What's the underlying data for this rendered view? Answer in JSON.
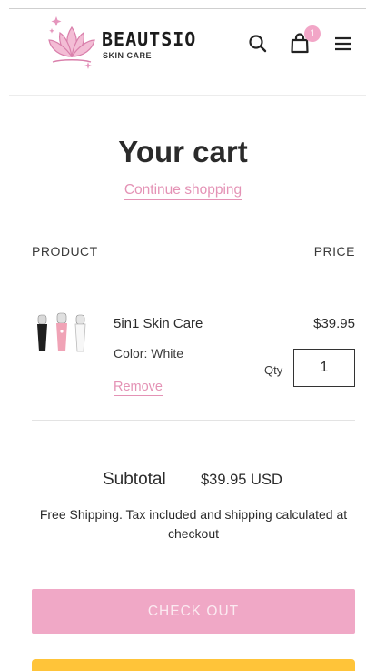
{
  "header": {
    "brand_name": "BEAUTSIO",
    "tagline": "SKIN CARE",
    "cart_count": "1"
  },
  "main": {
    "title": "Your cart",
    "continue_label": "Continue shopping",
    "columns": {
      "product": "PRODUCT",
      "price": "PRICE"
    },
    "item": {
      "name": "5in1 Skin Care",
      "variant": "Color: White",
      "remove_label": "Remove",
      "price": "$39.95",
      "qty_label": "Qty",
      "quantity": "1"
    },
    "subtotal": {
      "label": "Subtotal",
      "value": "$39.95 USD"
    },
    "shipping_note": "Free Shipping. Tax included and shipping calculated at checkout",
    "checkout_label": "CHECK OUT"
  },
  "colors": {
    "accent_pink": "#e492b5",
    "checkout_bg": "#f0a8c6",
    "paypal_yellow": "#ffc439"
  },
  "icons": [
    "lotus-logo-icon",
    "search-icon",
    "shopping-bag-icon",
    "hamburger-menu-icon",
    "product-thumbnail"
  ]
}
